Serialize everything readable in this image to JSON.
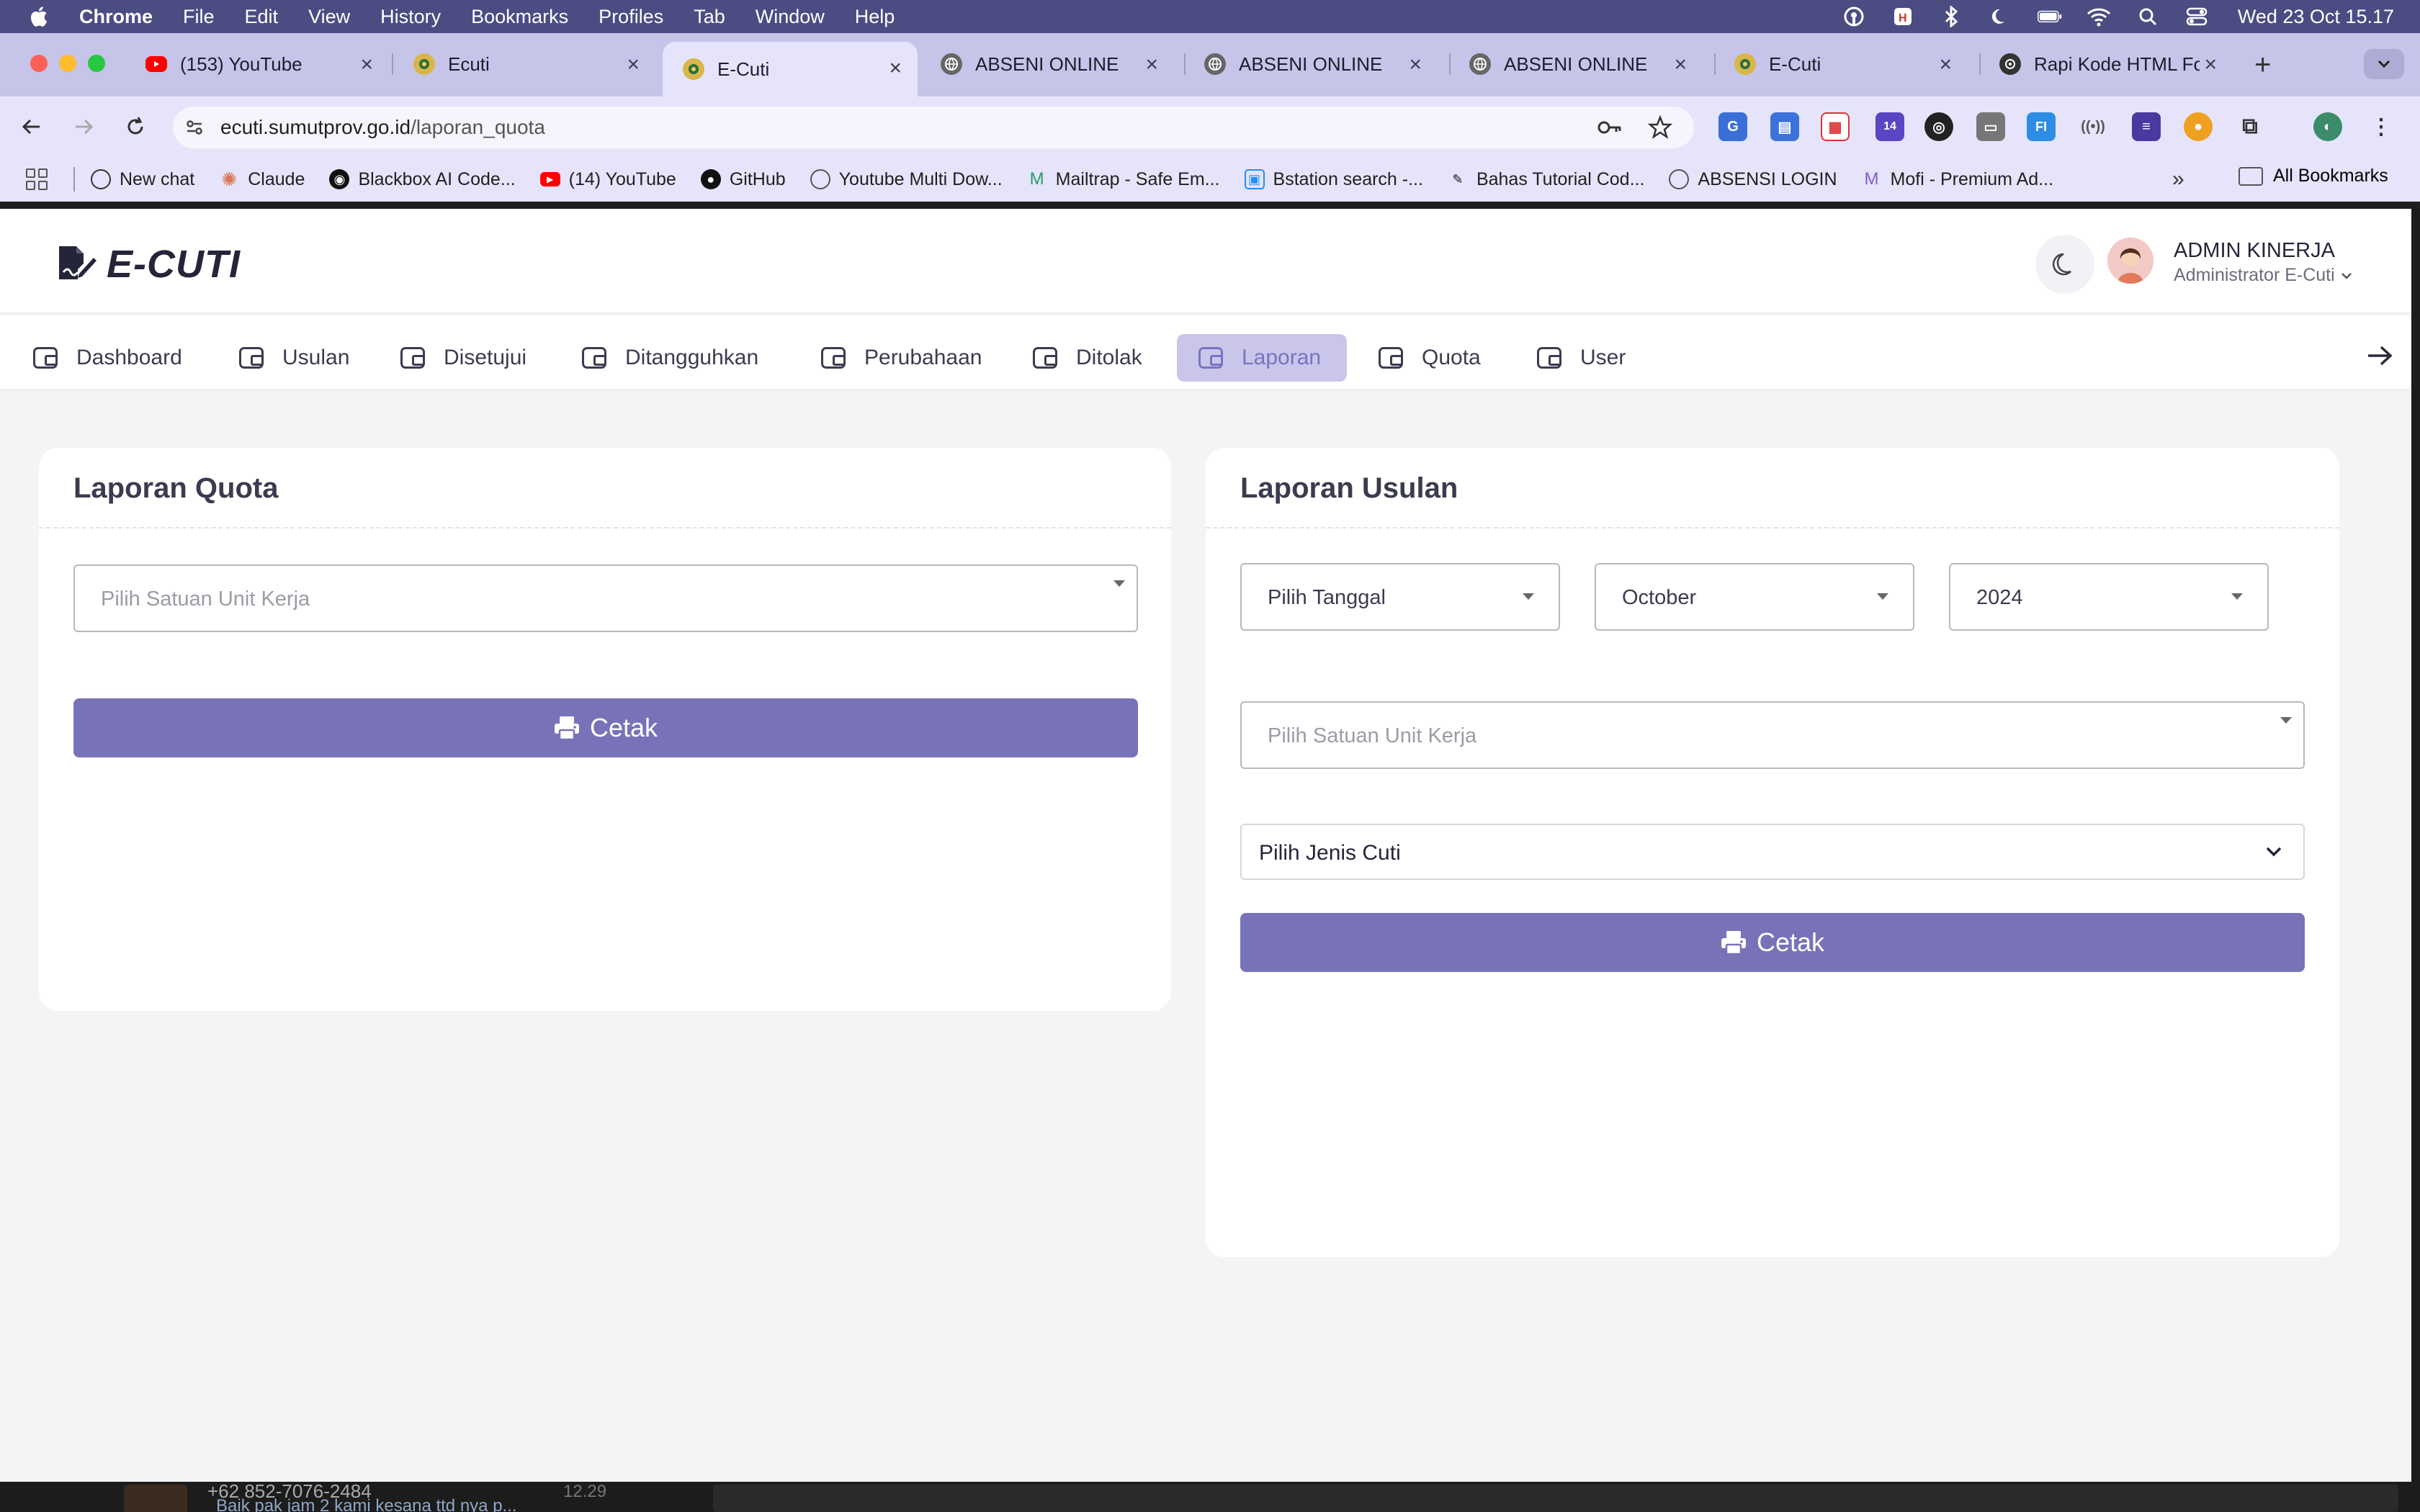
{
  "menubar": {
    "app": "Chrome",
    "items": [
      "File",
      "Edit",
      "View",
      "History",
      "Bookmarks",
      "Profiles",
      "Tab",
      "Window",
      "Help"
    ],
    "clock": "Wed 23 Oct  15.17"
  },
  "tabs": [
    {
      "title": "(153) YouTube"
    },
    {
      "title": "Ecuti"
    },
    {
      "title": "E-Cuti"
    },
    {
      "title": "ABSENI ONLINE"
    },
    {
      "title": "ABSENI ONLINE"
    },
    {
      "title": "ABSENI ONLINE"
    },
    {
      "title": "E-Cuti"
    },
    {
      "title": "Rapi Kode HTML Fo"
    }
  ],
  "omnibox": {
    "host": "ecuti.sumutprov.go.id",
    "path": "/laporan_quota"
  },
  "extensions": {
    "badge": "14"
  },
  "bookmarks": {
    "items": [
      {
        "label": "New chat"
      },
      {
        "label": "Claude"
      },
      {
        "label": "Blackbox AI Code..."
      },
      {
        "label": "(14) YouTube"
      },
      {
        "label": "GitHub"
      },
      {
        "label": "Youtube Multi Dow..."
      },
      {
        "label": "Mailtrap - Safe Em..."
      },
      {
        "label": "Bstation search -..."
      },
      {
        "label": "Bahas Tutorial Cod..."
      },
      {
        "label": "ABSENSI LOGIN"
      },
      {
        "label": "Mofi - Premium Ad..."
      }
    ],
    "more": "»",
    "all": "All Bookmarks"
  },
  "app": {
    "logo": "E-CUTI",
    "user_name": "ADMIN KINERJA",
    "user_role": "Administrator E-Cuti"
  },
  "nav": {
    "items": [
      "Dashboard",
      "Usulan",
      "Disetujui",
      "Ditangguhkan",
      "Perubahaan",
      "Ditolak",
      "Laporan",
      "Quota",
      "User"
    ],
    "active": "Laporan"
  },
  "quota_card": {
    "title": "Laporan Quota",
    "unit_placeholder": "Pilih Satuan Unit Kerja",
    "button": "Cetak"
  },
  "usulan_card": {
    "title": "Laporan Usulan",
    "date_value": "Pilih Tanggal",
    "month_value": "October",
    "year_value": "2024",
    "unit_placeholder": "Pilih Satuan Unit Kerja",
    "leave_type_value": "Pilih Jenis Cuti",
    "button": "Cetak"
  },
  "background_window": {
    "phone": "+62 852-7076-2484",
    "message": "Baik pak jam 2 kami kesana ttd nya p...",
    "time": "12.29"
  },
  "colors": {
    "accent": "#7872b8",
    "nav_active_bg": "#c9c6ea",
    "tab_strip": "#c6c4e8",
    "menubar": "#4b4c82"
  }
}
